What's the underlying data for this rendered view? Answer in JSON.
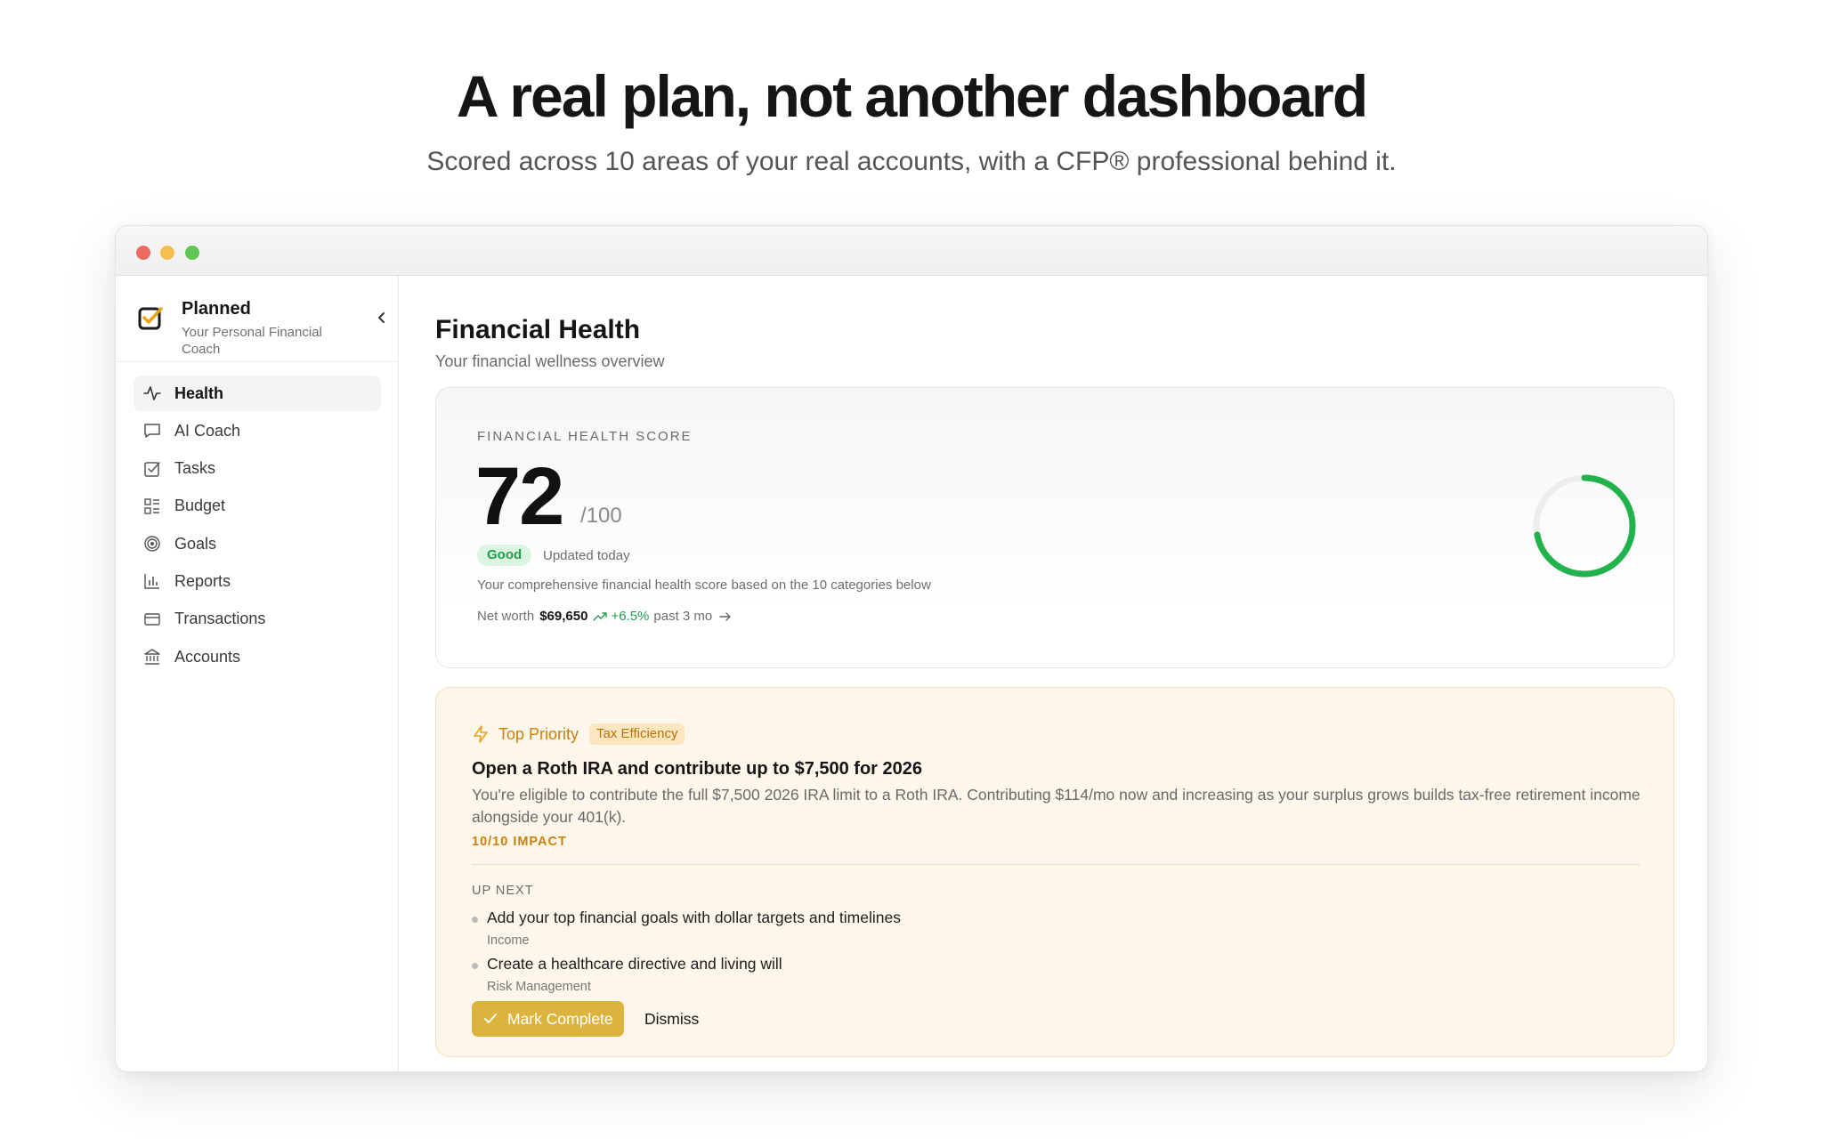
{
  "hero": {
    "title": "A real plan, not another dashboard",
    "subtitle": "Scored across 10 areas of your real accounts, with a CFP® professional behind it."
  },
  "sidebar": {
    "brand_name": "Planned",
    "brand_tagline": "Your Personal Financial Coach",
    "items": [
      {
        "label": "Health",
        "icon": "activity-icon",
        "active": true
      },
      {
        "label": "AI Coach",
        "icon": "chat-icon"
      },
      {
        "label": "Tasks",
        "icon": "checkbox-icon"
      },
      {
        "label": "Budget",
        "icon": "list-grid-icon"
      },
      {
        "label": "Goals",
        "icon": "target-icon"
      },
      {
        "label": "Reports",
        "icon": "bar-chart-icon"
      },
      {
        "label": "Transactions",
        "icon": "credit-card-icon"
      },
      {
        "label": "Accounts",
        "icon": "bank-icon"
      }
    ]
  },
  "main": {
    "title": "Financial Health",
    "subtitle": "Your financial wellness overview"
  },
  "score": {
    "label": "FINANCIAL HEALTH SCORE",
    "value": "72",
    "max": "/100",
    "fraction": 0.72,
    "badge": "Good",
    "updated": "Updated today",
    "description": "Your comprehensive financial health score based on the 10 categories below",
    "networth_label": "Net worth",
    "networth_value": "$69,650",
    "networth_change": "+6.5%",
    "networth_period": "past 3 mo"
  },
  "priority": {
    "label": "Top Priority",
    "tag": "Tax Efficiency",
    "title": "Open a Roth IRA and contribute up to $7,500 for 2026",
    "description": "You're eligible to contribute the full $7,500 2026 IRA limit to a Roth IRA. Contributing $114/mo now and increasing as your surplus grows builds tax-free retirement income alongside your 401(k).",
    "impact": "10/10 IMPACT",
    "up_next_label": "UP NEXT",
    "up_next": [
      {
        "title": "Add your top financial goals with dollar targets and timelines",
        "category": "Income"
      },
      {
        "title": "Create a healthcare directive and living will",
        "category": "Risk Management"
      }
    ],
    "complete_label": "Mark Complete",
    "dismiss_label": "Dismiss"
  },
  "colors": {
    "accent_green": "#22b24c",
    "accent_amber": "#c9810d",
    "button_gold": "#dcb33c"
  }
}
